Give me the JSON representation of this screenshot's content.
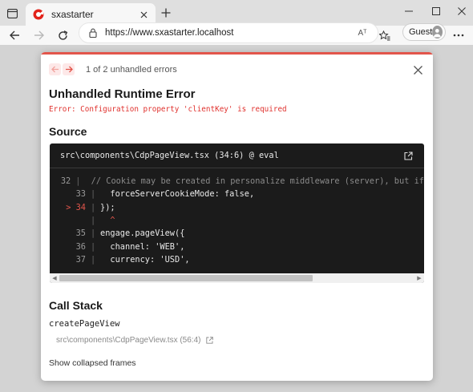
{
  "browser": {
    "tab": {
      "title": "sxastarter"
    },
    "address": {
      "url": "https://www.sxastarter.localhost"
    },
    "profile": {
      "label": "Guest"
    },
    "read_aloud": "Aᵀ"
  },
  "overlay": {
    "pager": {
      "text": "1 of 2 unhandled errors"
    },
    "title": "Unhandled Runtime Error",
    "message": "Error: Configuration property 'clientKey' is required",
    "source": {
      "heading": "Source",
      "file": "src\\components\\CdpPageView.tsx (34:6) @ eval",
      "lines": [
        {
          "num": "32",
          "marker": "",
          "code": "  // Cookie may be created in personalize middleware (server), but if"
        },
        {
          "num": "33",
          "marker": "",
          "code": "  forceServerCookieMode: false,"
        },
        {
          "num": "34",
          "marker": ">",
          "code": "});"
        },
        {
          "num": "",
          "marker": "",
          "code": "  ^"
        },
        {
          "num": "35",
          "marker": "",
          "code": "engage.pageView({"
        },
        {
          "num": "36",
          "marker": "",
          "code": "  channel: 'WEB',"
        },
        {
          "num": "37",
          "marker": "",
          "code": "  currency: 'USD',"
        }
      ]
    },
    "call_stack": {
      "heading": "Call Stack",
      "function": "createPageView",
      "location": "src\\components\\CdpPageView.tsx (56:4)",
      "collapsed_label": "Show collapsed frames"
    }
  },
  "colors": {
    "accent_red": "#e2554b",
    "error_text": "#e0322e",
    "code_bg": "#1b1b1b"
  }
}
